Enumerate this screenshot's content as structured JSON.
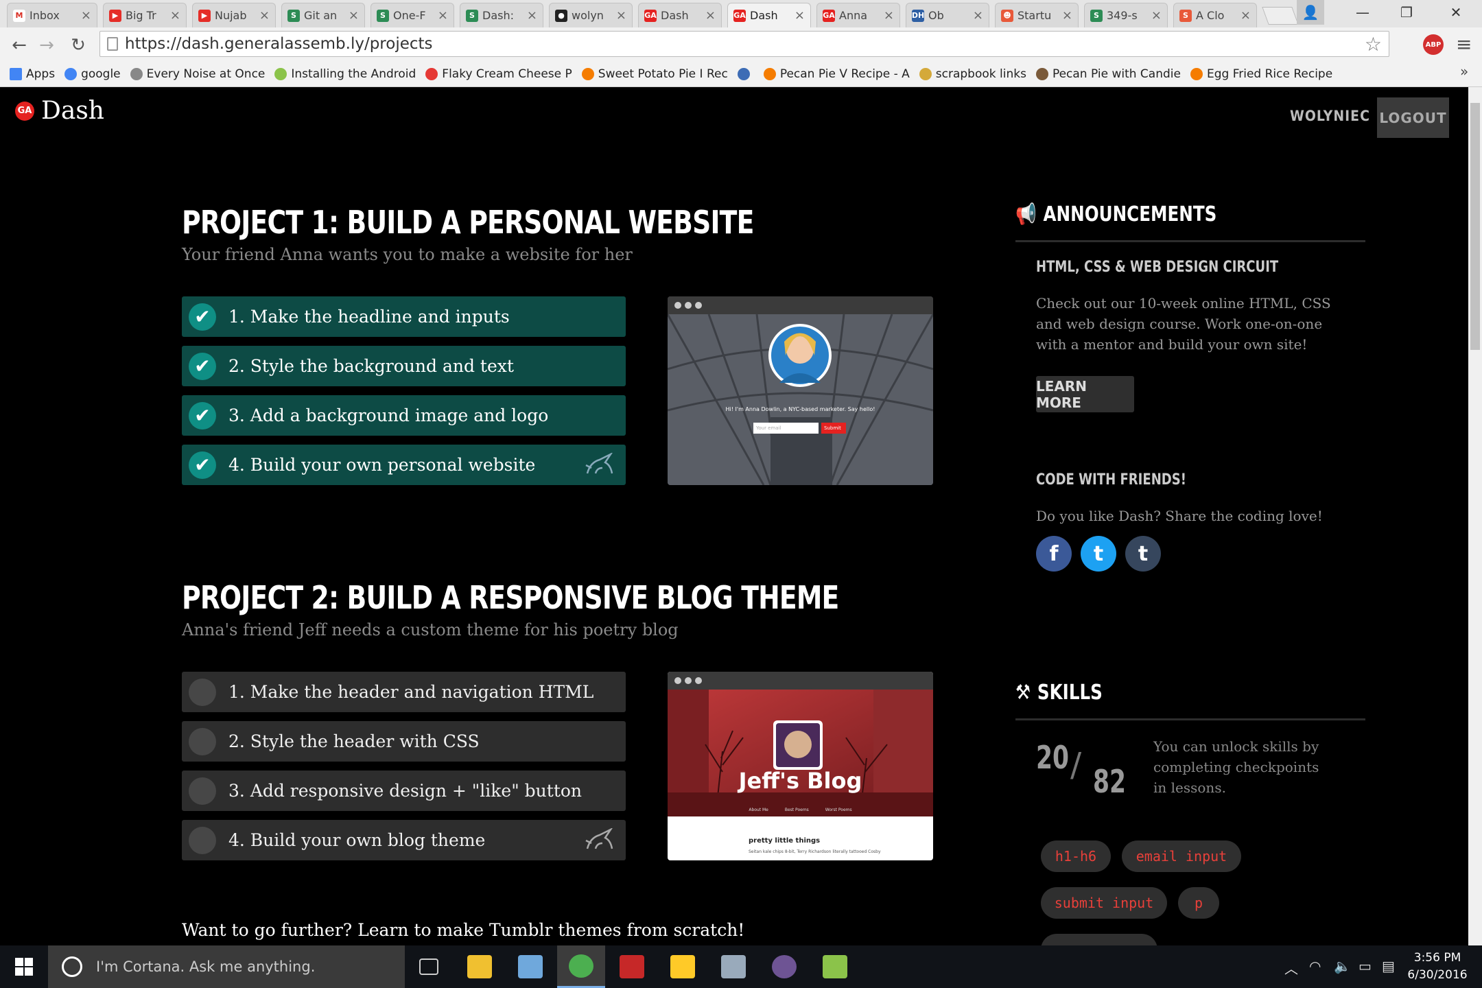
{
  "browser": {
    "tabs": [
      {
        "title": "Inbox",
        "fav": "M",
        "color": "#ffffff",
        "fg": "#d93025"
      },
      {
        "title": "Big Tr",
        "fav": "▶",
        "color": "#e52d27",
        "fg": "#fff"
      },
      {
        "title": "Nujab",
        "fav": "▶",
        "color": "#e52d27",
        "fg": "#fff"
      },
      {
        "title": "Git an",
        "fav": "S",
        "color": "#2d8c55",
        "fg": "#fff"
      },
      {
        "title": "One-F",
        "fav": "S",
        "color": "#2d8c55",
        "fg": "#fff"
      },
      {
        "title": "Dash:",
        "fav": "S",
        "color": "#2d8c55",
        "fg": "#fff"
      },
      {
        "title": "wolyn",
        "fav": "●",
        "color": "#222",
        "fg": "#fff"
      },
      {
        "title": "Dash",
        "fav": "GA",
        "color": "#e52220",
        "fg": "#fff"
      },
      {
        "title": "Dash",
        "fav": "GA",
        "color": "#e52220",
        "fg": "#fff"
      },
      {
        "title": "Anna",
        "fav": "GA",
        "color": "#e52220",
        "fg": "#fff"
      },
      {
        "title": "Ob",
        "fav": "DH",
        "color": "#2e5fa4",
        "fg": "#fff"
      },
      {
        "title": "Startu",
        "fav": "☻",
        "color": "#e8593a",
        "fg": "#fff"
      },
      {
        "title": "349-s",
        "fav": "S",
        "color": "#2d8c55",
        "fg": "#fff"
      },
      {
        "title": "A Clo",
        "fav": "S",
        "color": "#e8593a",
        "fg": "#fff"
      }
    ],
    "url": "https://dash.generalassemb.ly/projects",
    "bookmarks": [
      "Apps",
      "google",
      "Every Noise at Once",
      "Installing the Android",
      "Flaky Cream Cheese P",
      "Sweet Potato Pie I Rec",
      "",
      "Pecan Pie V Recipe - A",
      "scrapbook links",
      "Pecan Pie with Candie",
      "Egg Fried Rice Recipe"
    ],
    "bookmark_colors": [
      "#4285f4",
      "#4285f4",
      "#888",
      "#8bc34a",
      "#e53935",
      "#f57c00",
      "#3d6cb5",
      "#f57c00",
      "#d4a93a",
      "#7a5a3a",
      "#f57c00"
    ],
    "abp": "ABP",
    "more": "»"
  },
  "header": {
    "ga": "GA",
    "brand": "Dash",
    "username": "WOLYNIEC",
    "logout": "LOGOUT"
  },
  "projects": [
    {
      "title": "PROJECT 1: BUILD A PERSONAL WEBSITE",
      "subtitle": "Your friend Anna wants you to make a website for her",
      "steps": [
        {
          "label": "1. Make the headline and inputs",
          "done": true
        },
        {
          "label": "2. Style the background and text",
          "done": true
        },
        {
          "label": "3. Add a background image and logo",
          "done": true
        },
        {
          "label": "4. Build your own personal website",
          "done": true
        }
      ],
      "preview": {
        "caption": "Hi! I'm Anna Dowlin, a NYC-based marketer. Say hello!",
        "placeholder": "Your email",
        "button": "Submit"
      }
    },
    {
      "title": "PROJECT 2: BUILD A RESPONSIVE BLOG THEME",
      "subtitle": "Anna's friend Jeff needs a custom theme for his poetry blog",
      "steps": [
        {
          "label": "1. Make the header and navigation HTML",
          "done": false
        },
        {
          "label": "2. Style the header with CSS",
          "done": false
        },
        {
          "label": "3. Add responsive design + \"like\" button",
          "done": false
        },
        {
          "label": "4. Build your own blog theme",
          "done": false
        }
      ],
      "preview": {
        "blog_title": "Jeff's Blog",
        "nav": [
          "About Me",
          "Best Poems",
          "Worst Poems"
        ],
        "post_title": "pretty little things",
        "post_text": "Seitan kale chips 8-bit, Terry Richardson literally tattooed Cosby"
      }
    }
  ],
  "further": "Want to go further? Learn to make Tumblr themes from scratch!",
  "sidebar": {
    "announcements_title": "ANNOUNCEMENTS",
    "circuit_title": "HTML, CSS & WEB DESIGN CIRCUIT",
    "circuit_text": "Check out our 10-week online HTML, CSS and web design course. Work one-on-one with a mentor and build your own site!",
    "learn_more": "LEARN MORE",
    "friends_title": "CODE WITH FRIENDS!",
    "friends_text": "Do you like Dash? Share the coding love!",
    "social": [
      {
        "name": "facebook",
        "glyph": "f",
        "color": "#3b5998"
      },
      {
        "name": "twitter",
        "glyph": "t",
        "color": "#1da1f2"
      },
      {
        "name": "tumblr",
        "glyph": "t",
        "color": "#36465d"
      }
    ],
    "skills_title": "SKILLS",
    "skills_unlocked": "20",
    "skills_total": "82",
    "skills_text": "You can unlock skills by completing checkpoints in lessons.",
    "tags": [
      "h1-h6",
      "email input",
      "submit input",
      "p"
    ]
  },
  "taskbar": {
    "cortana": "I'm Cortana. Ask me anything.",
    "time": "3:56 PM",
    "date": "6/30/2016",
    "apps": [
      {
        "name": "task-view",
        "color": "#555"
      },
      {
        "name": "file-explorer",
        "color": "#f0c030"
      },
      {
        "name": "paint",
        "color": "#6fa8dc"
      },
      {
        "name": "chrome",
        "color": "#4caf50"
      },
      {
        "name": "flash",
        "color": "#c62828"
      },
      {
        "name": "app-yellow",
        "color": "#ffca28"
      },
      {
        "name": "app-window",
        "color": "#9ab"
      },
      {
        "name": "github",
        "color": "#6e5494"
      },
      {
        "name": "app-green",
        "color": "#8bc34a"
      }
    ]
  }
}
